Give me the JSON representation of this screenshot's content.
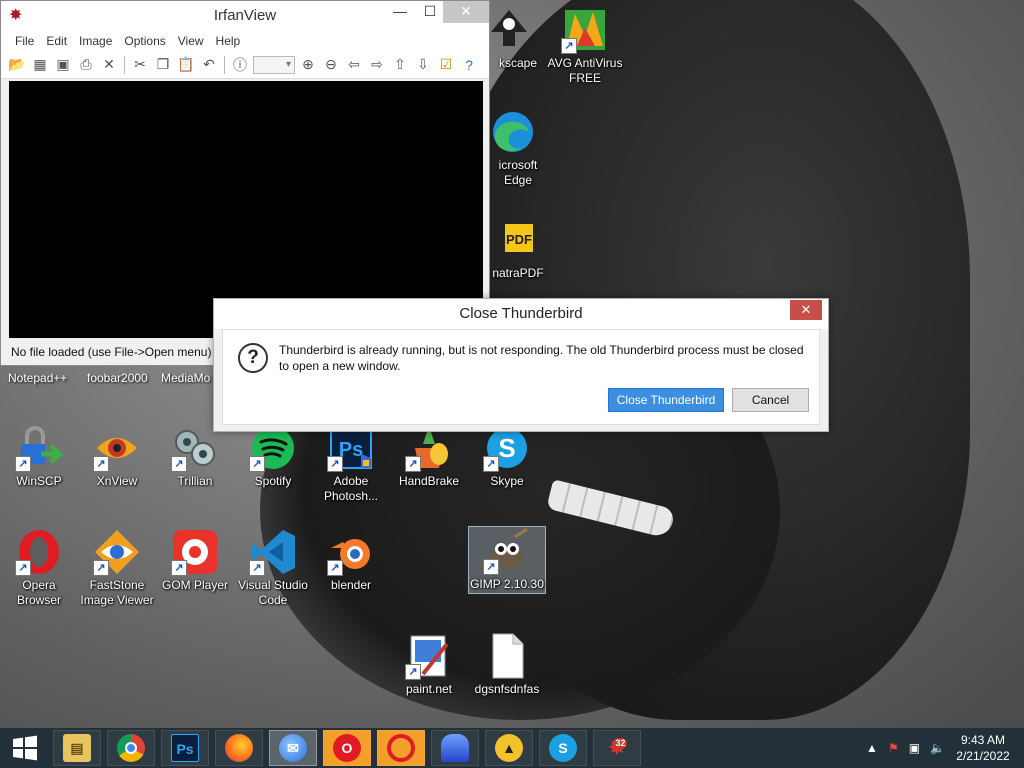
{
  "irfanview": {
    "title": "IrfanView",
    "menu": [
      "File",
      "Edit",
      "Image",
      "Options",
      "View",
      "Help"
    ],
    "status": "No file loaded (use File->Open menu)"
  },
  "dialog": {
    "title": "Close Thunderbird",
    "message": "Thunderbird is already running, but is not responding. The old Thunderbird process must be closed to open a new window.",
    "primary_button": "Close Thunderbird",
    "cancel_button": "Cancel"
  },
  "desktop": {
    "top_icons": [
      {
        "label": "kscape"
      },
      {
        "label": "AVG AntiVirus FREE"
      },
      {
        "label": "icrosoft Edge"
      },
      {
        "label": "natraPDF"
      }
    ],
    "row1_labels": [
      "Notepad++",
      "foobar2000",
      "MediaMo"
    ],
    "row2": [
      {
        "label": "WinSCP"
      },
      {
        "label": "XnView"
      },
      {
        "label": "Trillian"
      },
      {
        "label": "Spotify"
      },
      {
        "label": "Adobe Photosh..."
      },
      {
        "label": "HandBrake"
      },
      {
        "label": "Skype"
      }
    ],
    "row3": [
      {
        "label": "Opera Browser"
      },
      {
        "label": "FastStone Image Viewer"
      },
      {
        "label": "GOM Player"
      },
      {
        "label": "Visual Studio Code"
      },
      {
        "label": "blender"
      },
      {
        "label": "GIMP 2.10.30"
      }
    ],
    "row4": [
      {
        "label": "paint.net"
      },
      {
        "label": "dgsnfsdnfas"
      }
    ]
  },
  "taskbar": {
    "time": "9:43 AM",
    "date": "2/21/2022",
    "badge": "32"
  }
}
